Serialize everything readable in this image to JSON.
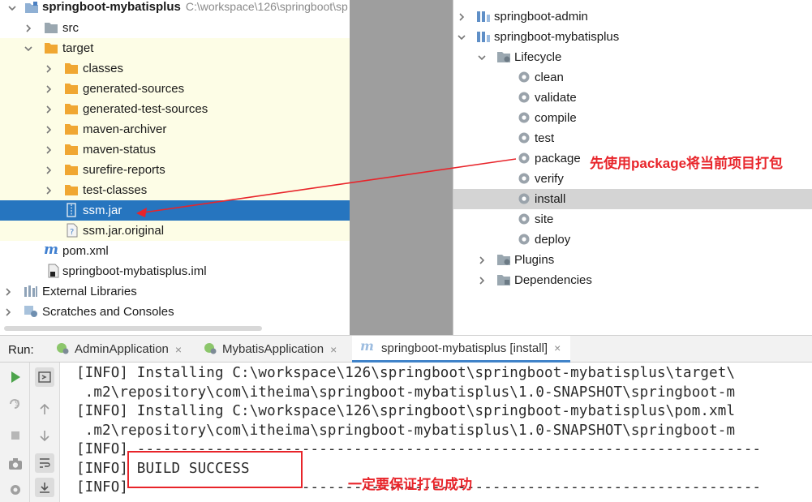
{
  "project_tree": {
    "root": {
      "label": "springboot-mybatisplus",
      "path_hint": "C:\\workspace\\126\\springboot\\sp"
    },
    "items": [
      {
        "label": "src",
        "type": "folder"
      },
      {
        "label": "target",
        "type": "folder-orange"
      },
      {
        "label": "classes",
        "type": "folder-orange"
      },
      {
        "label": "generated-sources",
        "type": "folder-orange"
      },
      {
        "label": "generated-test-sources",
        "type": "folder-orange"
      },
      {
        "label": "maven-archiver",
        "type": "folder-orange"
      },
      {
        "label": "maven-status",
        "type": "folder-orange"
      },
      {
        "label": "surefire-reports",
        "type": "folder-orange"
      },
      {
        "label": "test-classes",
        "type": "folder-orange"
      },
      {
        "label": "ssm.jar",
        "type": "jar"
      },
      {
        "label": "ssm.jar.original",
        "type": "file-unknown"
      },
      {
        "label": "pom.xml",
        "type": "maven-file"
      },
      {
        "label": "springboot-mybatisplus.iml",
        "type": "iml-file"
      },
      {
        "label": "External Libraries",
        "type": "libraries"
      },
      {
        "label": "Scratches and Consoles",
        "type": "scratches"
      }
    ]
  },
  "maven": {
    "projects": [
      {
        "label": "springboot-admin"
      },
      {
        "label": "springboot-mybatisplus"
      }
    ],
    "lifecycle_label": "Lifecycle",
    "phases": [
      "clean",
      "validate",
      "compile",
      "test",
      "package",
      "verify",
      "install",
      "site",
      "deploy"
    ],
    "plugins_label": "Plugins",
    "dependencies_label": "Dependencies"
  },
  "run": {
    "title": "Run:",
    "tabs": [
      {
        "label": "AdminApplication",
        "close": "×"
      },
      {
        "label": "MybatisApplication",
        "close": "×"
      },
      {
        "label": "springboot-mybatisplus [install]",
        "close": "×"
      }
    ],
    "console_lines": [
      "[INFO] Installing C:\\workspace\\126\\springboot\\springboot-mybatisplus\\target\\",
      " .m2\\repository\\com\\itheima\\springboot-mybatisplus\\1.0-SNAPSHOT\\springboot-m",
      "[INFO] Installing C:\\workspace\\126\\springboot\\springboot-mybatisplus\\pom.xml",
      " .m2\\repository\\com\\itheima\\springboot-mybatisplus\\1.0-SNAPSHOT\\springboot-m",
      "[INFO] ------------------------------------------------------------------------",
      "[INFO] BUILD SUCCESS",
      "[INFO] ------------------------------------------------------------------------"
    ]
  },
  "annotations": {
    "package_note": "先使用package将当前项目打包",
    "success_note": "一定要保证打包成功"
  },
  "colors": {
    "selection": "#2675bf",
    "annotation": "#e8242a",
    "folder_orange": "#f0a732",
    "gutter": "#9e9e9e"
  }
}
